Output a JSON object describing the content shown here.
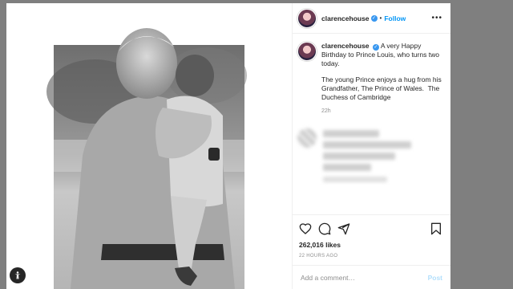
{
  "post": {
    "username": "clarencehouse",
    "follow_label": "Follow",
    "dot": "•",
    "more_icon": "more-horizontal-icon"
  },
  "caption": {
    "username": "clarencehouse",
    "line1": "⁣A very Happy Birthday to Prince Louis, who turns two today.",
    "line2": "The young Prince enjoys a hug from his Grandfather, The Prince of Wales. ⁣ The Duchess of Cambridge",
    "time": "22h"
  },
  "actions": {
    "icons": [
      "heart-icon",
      "comment-icon",
      "share-icon",
      "bookmark-icon"
    ],
    "likes": "262,016 likes",
    "posted": "22 HOURS AGO"
  },
  "comment_box": {
    "placeholder": "Add a comment…",
    "post_label": "Post"
  },
  "colors": {
    "accent": "#0095f6",
    "verified": "#3897f0",
    "overlay": "#7f7f7f"
  }
}
